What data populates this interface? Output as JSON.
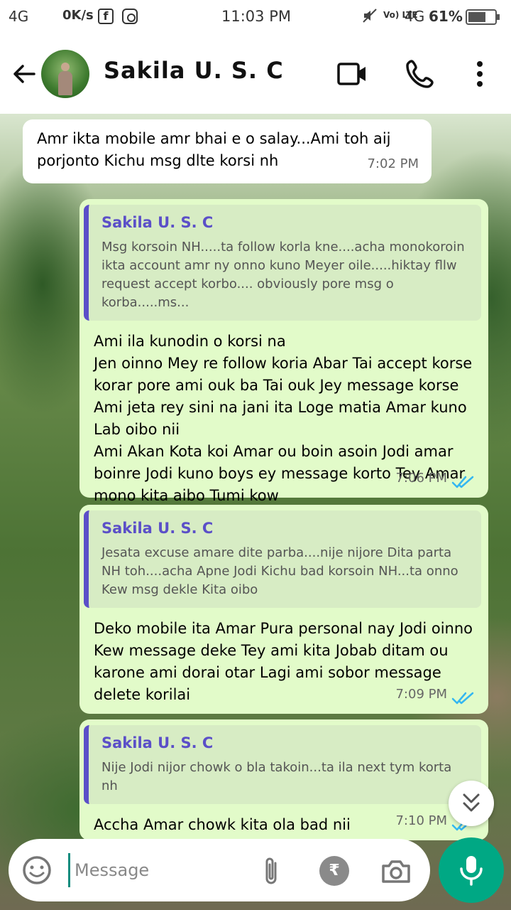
{
  "status_bar": {
    "signal": "4G",
    "speed": "0K/s",
    "facebook_icon_glyph": "f",
    "time": "11:03 PM",
    "volte": "Vo) LTE",
    "network": "4G",
    "battery": "61%"
  },
  "header": {
    "contact_name": "Sakila U. S. C"
  },
  "messages": [
    {
      "direction": "incoming",
      "text": "Amr ikta mobile amr bhai e o salay...Ami toh aij porjonto Kichu msg dlte korsi nh",
      "time": "7:02 PM"
    },
    {
      "direction": "outgoing",
      "quote_author": "Sakila U. S. C",
      "quote_text": "Msg korsoin NH.....ta follow korla kne....acha monokoroin ikta account amr ny onno kuno Meyer oile.....hiktay fllw request accept korbo.... obviously pore msg o korba.....ms...",
      "text": "Ami ila kunodin o korsi na\nJen oinno Mey re follow koria Abar Tai accept korse korar pore ami ouk ba Tai ouk Jey message korse Ami jeta rey sini na jani ita Loge matia Amar kuno Lab oibo nii\nAmi Akan Kota koi Amar ou boin asoin Jodi amar boinre Jodi kuno boys ey message korto Tey Amar mono kita aibo Tumi kow",
      "time": "7:06 PM",
      "status": "read"
    },
    {
      "direction": "outgoing",
      "quote_author": "Sakila U. S. C",
      "quote_text": "Jesata excuse amare dite parba....nije nijore Dita parta NH toh....acha Apne Jodi Kichu bad korsoin NH...ta onno Kew msg dekle Kita oibo",
      "text": "Deko mobile ita Amar Pura personal nay Jodi oinno Kew message deke Tey ami kita Jobab ditam ou karone ami dorai otar Lagi ami sobor message delete korilai",
      "time": "7:09 PM",
      "status": "read"
    },
    {
      "direction": "outgoing",
      "quote_author": "Sakila U. S. C",
      "quote_text": "Nije Jodi nijor chowk o bla takoin...ta ila next tym korta nh",
      "text": "Accha Amar chowk kita ola bad nii",
      "time": "7:10 PM",
      "status": "read"
    }
  ],
  "input": {
    "placeholder": "Message",
    "payment_symbol": "₹"
  },
  "colors": {
    "outgoing_bubble": "#e2fbc9",
    "incoming_bubble": "#ffffff",
    "quote_accent": "#5b4fc8",
    "read_ticks": "#34b7f1",
    "mic_button": "#00a884"
  }
}
